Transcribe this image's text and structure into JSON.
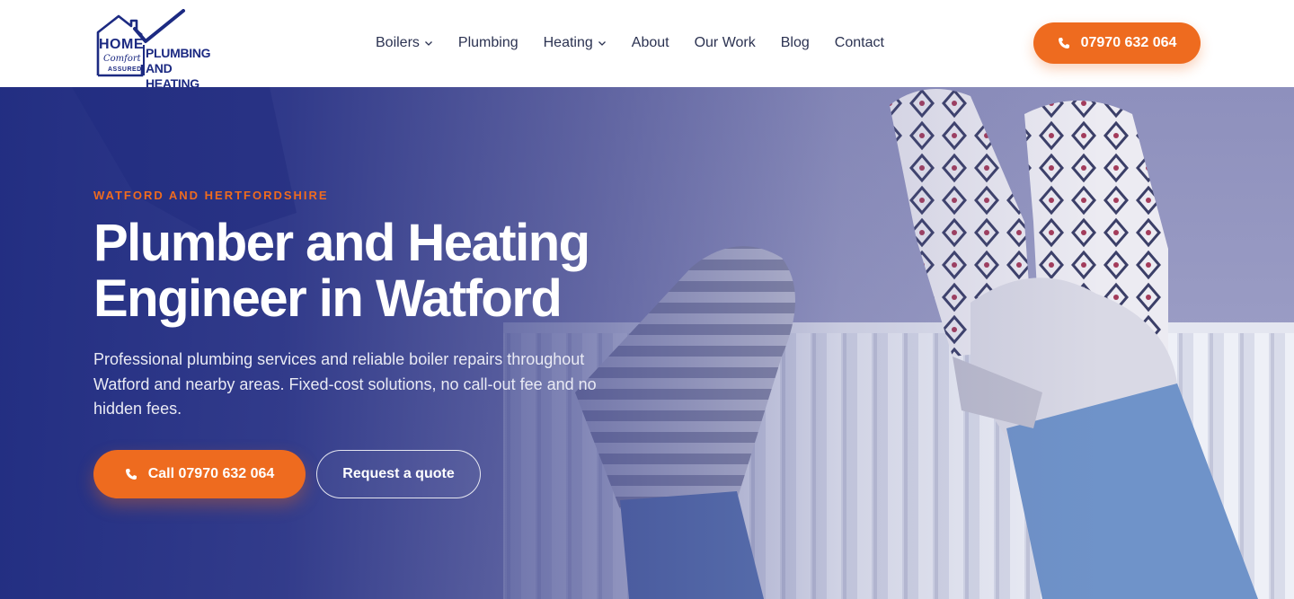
{
  "brand": {
    "logo_home": "HOME",
    "logo_comfort": "Comfort",
    "logo_assured": "ASSURED",
    "logo_line1": "PLUMBING AND",
    "logo_line2": "HEATING",
    "logo_color": "#1c2a82"
  },
  "nav": {
    "items": [
      {
        "label": "Boilers",
        "has_dropdown": true
      },
      {
        "label": "Plumbing",
        "has_dropdown": false
      },
      {
        "label": "Heating",
        "has_dropdown": true
      },
      {
        "label": "About",
        "has_dropdown": false
      },
      {
        "label": "Our Work",
        "has_dropdown": false
      },
      {
        "label": "Blog",
        "has_dropdown": false
      },
      {
        "label": "Contact",
        "has_dropdown": false
      }
    ],
    "phone_label": "07970 632 064"
  },
  "hero": {
    "eyebrow": "WATFORD AND HERTFORDSHIRE",
    "title": "Plumber and Heating Engineer in Watford",
    "description": "Professional plumbing services and reliable boiler repairs throughout Watford and nearby areas. Fixed-cost solutions, no call-out fee and no hidden fees.",
    "call_button_label": "Call 07970 632 064",
    "quote_button_label": "Request a quote"
  },
  "icons": {
    "phone": "phone-icon",
    "chevron": "chevron-down-icon",
    "logo_check": "checkmark-icon"
  },
  "colors": {
    "accent": "#ee6b1f",
    "navy": "#1f2b80",
    "nav_text": "#2b3251"
  }
}
